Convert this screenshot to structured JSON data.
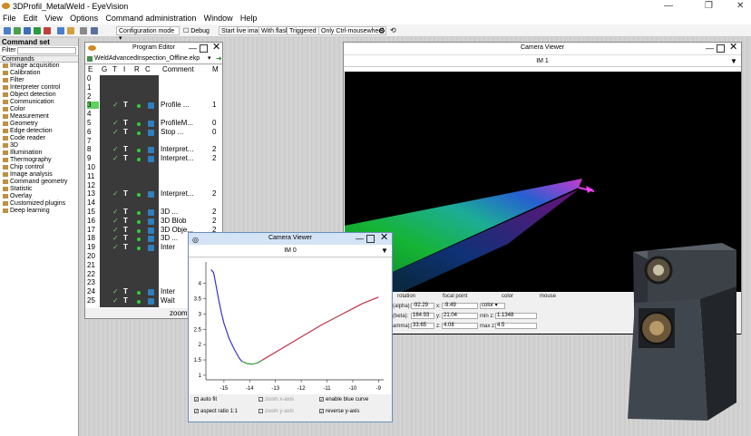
{
  "window": {
    "title": "3DProfil_MetalWeld - EyeVision"
  },
  "menu": [
    "File",
    "Edit",
    "View",
    "Options",
    "Command administration",
    "Window",
    "Help"
  ],
  "toolbar": {
    "mode": "Configuration mode",
    "debug": "Debug",
    "start_live": "Start live image",
    "with_flash": "With flash",
    "triggered": "Triggered",
    "mousewheel": "Only Ctrl-mousewheel"
  },
  "command_set": {
    "title": "Command set",
    "filter_label": "Filter",
    "filter_value": "",
    "list_header": "Commands",
    "items": [
      "Image acquisition",
      "Calibration",
      "Filter",
      "Interpreter control",
      "Object detection",
      "Communication",
      "Color",
      "Measurement",
      "Geometry",
      "Edge detection",
      "Code reader",
      "3D",
      "Illumination",
      "Thermography",
      "Chip control",
      "Image analysis",
      "Command geometry",
      "Statistic",
      "Overlay",
      "Customized plugins",
      "Deep learning"
    ]
  },
  "program_editor": {
    "title": "Program Editor",
    "file": "WeldAdvancedInspection_Offline.ekp",
    "columns": [
      "E",
      "G",
      "T",
      "I",
      "R",
      "C",
      "Comment",
      "M"
    ],
    "rows": [
      {
        "n": "0",
        "c": "",
        "m": ""
      },
      {
        "n": "1",
        "c": "",
        "m": ""
      },
      {
        "n": "2",
        "c": "",
        "m": ""
      },
      {
        "n": "3",
        "c": "Profile ...",
        "m": "1"
      },
      {
        "n": "4",
        "c": "",
        "m": ""
      },
      {
        "n": "5",
        "c": "ProfileM...",
        "m": "0"
      },
      {
        "n": "6",
        "c": "Stop ...",
        "m": "0"
      },
      {
        "n": "7",
        "c": "",
        "m": ""
      },
      {
        "n": "8",
        "c": "Interpret...",
        "m": "2"
      },
      {
        "n": "9",
        "c": "Interpret...",
        "m": "2"
      },
      {
        "n": "10",
        "c": "",
        "m": ""
      },
      {
        "n": "11",
        "c": "",
        "m": ""
      },
      {
        "n": "12",
        "c": "",
        "m": ""
      },
      {
        "n": "13",
        "c": "Interpret...",
        "m": "2"
      },
      {
        "n": "14",
        "c": "",
        "m": ""
      },
      {
        "n": "15",
        "c": "3D ...",
        "m": "2"
      },
      {
        "n": "16",
        "c": "3D Blob",
        "m": "2"
      },
      {
        "n": "17",
        "c": "3D Obje...",
        "m": "2"
      },
      {
        "n": "18",
        "c": "3D ...",
        "m": "2"
      },
      {
        "n": "19",
        "c": "Inter",
        "m": ""
      },
      {
        "n": "20",
        "c": "",
        "m": ""
      },
      {
        "n": "21",
        "c": "",
        "m": ""
      },
      {
        "n": "22",
        "c": "",
        "m": ""
      },
      {
        "n": "23",
        "c": "",
        "m": ""
      },
      {
        "n": "24",
        "c": "Inter",
        "m": ""
      },
      {
        "n": "25",
        "c": "Wait",
        "m": ""
      }
    ],
    "zoom_label": "zoom:"
  },
  "camera_viewer_1": {
    "title": "Camera Viewer",
    "image": "IM 1",
    "headers": [
      "rotation",
      "focal point",
      "color",
      "mouse"
    ],
    "alpha_label": "(alpha):",
    "alpha": "-92.29",
    "beta_label": "(beta):",
    "beta": "164.93",
    "gamma_label": "amma):",
    "gamma": "33.65",
    "x_label": "x:",
    "x": "-9.49",
    "y_label": "y:",
    "y": "21.04",
    "z_label": "z:",
    "z": "4.08",
    "color_value": "color",
    "min_z_label": "min z:",
    "min_z": "1.1348",
    "max_z_label": "max z:",
    "max_z": "4.5"
  },
  "camera_viewer_0": {
    "title": "Camera Viewer",
    "image": "IM 0",
    "checkboxes": [
      {
        "label": "auto fit",
        "checked": true
      },
      {
        "label": "zoom x-axis",
        "checked": true
      },
      {
        "label": "enable blue curve",
        "checked": true
      },
      {
        "label": "aspect ratio 1:1",
        "checked": true
      },
      {
        "label": "zoom y-axis",
        "checked": true
      },
      {
        "label": "reverse y-axis",
        "checked": true
      }
    ]
  },
  "chart_data": {
    "type": "line",
    "x_ticks": [
      "-15",
      "-14",
      "-13",
      "-12",
      "-11",
      "-10",
      "-9"
    ],
    "y_ticks": [
      "1",
      "1.5",
      "2",
      "2.5",
      "3",
      "3.5",
      "4"
    ],
    "xlim": [
      -15.7,
      -8.8
    ],
    "ylim": [
      0.85,
      4.7
    ],
    "series": [
      {
        "color": "#3a34c8",
        "x": [
          -15.5,
          -15.4,
          -15.3,
          -15.2,
          -15.1,
          -15.0,
          -14.8,
          -14.6,
          -14.4,
          -14.3
        ],
        "y": [
          4.45,
          4.35,
          3.9,
          3.45,
          3.05,
          2.7,
          2.2,
          1.85,
          1.55,
          1.45
        ]
      },
      {
        "color": "#2e9a3a",
        "x": [
          -14.3,
          -14.1,
          -13.9,
          -13.7,
          -13.5
        ],
        "y": [
          1.45,
          1.38,
          1.36,
          1.4,
          1.5
        ]
      },
      {
        "color": "#c0304a",
        "x": [
          -13.5,
          -12.8,
          -12.0,
          -11.2,
          -10.4,
          -9.6,
          -9.0
        ],
        "y": [
          1.5,
          1.85,
          2.25,
          2.65,
          3.0,
          3.35,
          3.55
        ]
      }
    ]
  }
}
